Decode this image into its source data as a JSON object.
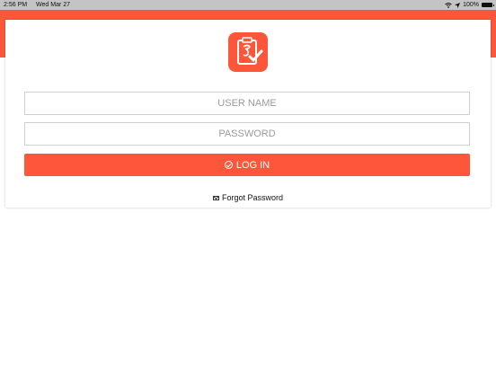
{
  "status_bar": {
    "time": "2:56 PM",
    "date": "Wed Mar 27",
    "battery": "100%"
  },
  "colors": {
    "accent": "#fe563a",
    "background": "#ffffff",
    "status_bar": "#c4c4c4"
  },
  "login": {
    "username_placeholder": "USER NAME",
    "password_placeholder": "PASSWORD",
    "login_label": "LOG IN",
    "forgot_label": "Forgot Password"
  },
  "icons": {
    "logo": "clipboard-check-logo-icon",
    "login": "check-circle-icon",
    "forgot": "mail-icon",
    "wifi": "wifi-icon",
    "location": "location-arrow-icon",
    "battery": "battery-icon"
  }
}
